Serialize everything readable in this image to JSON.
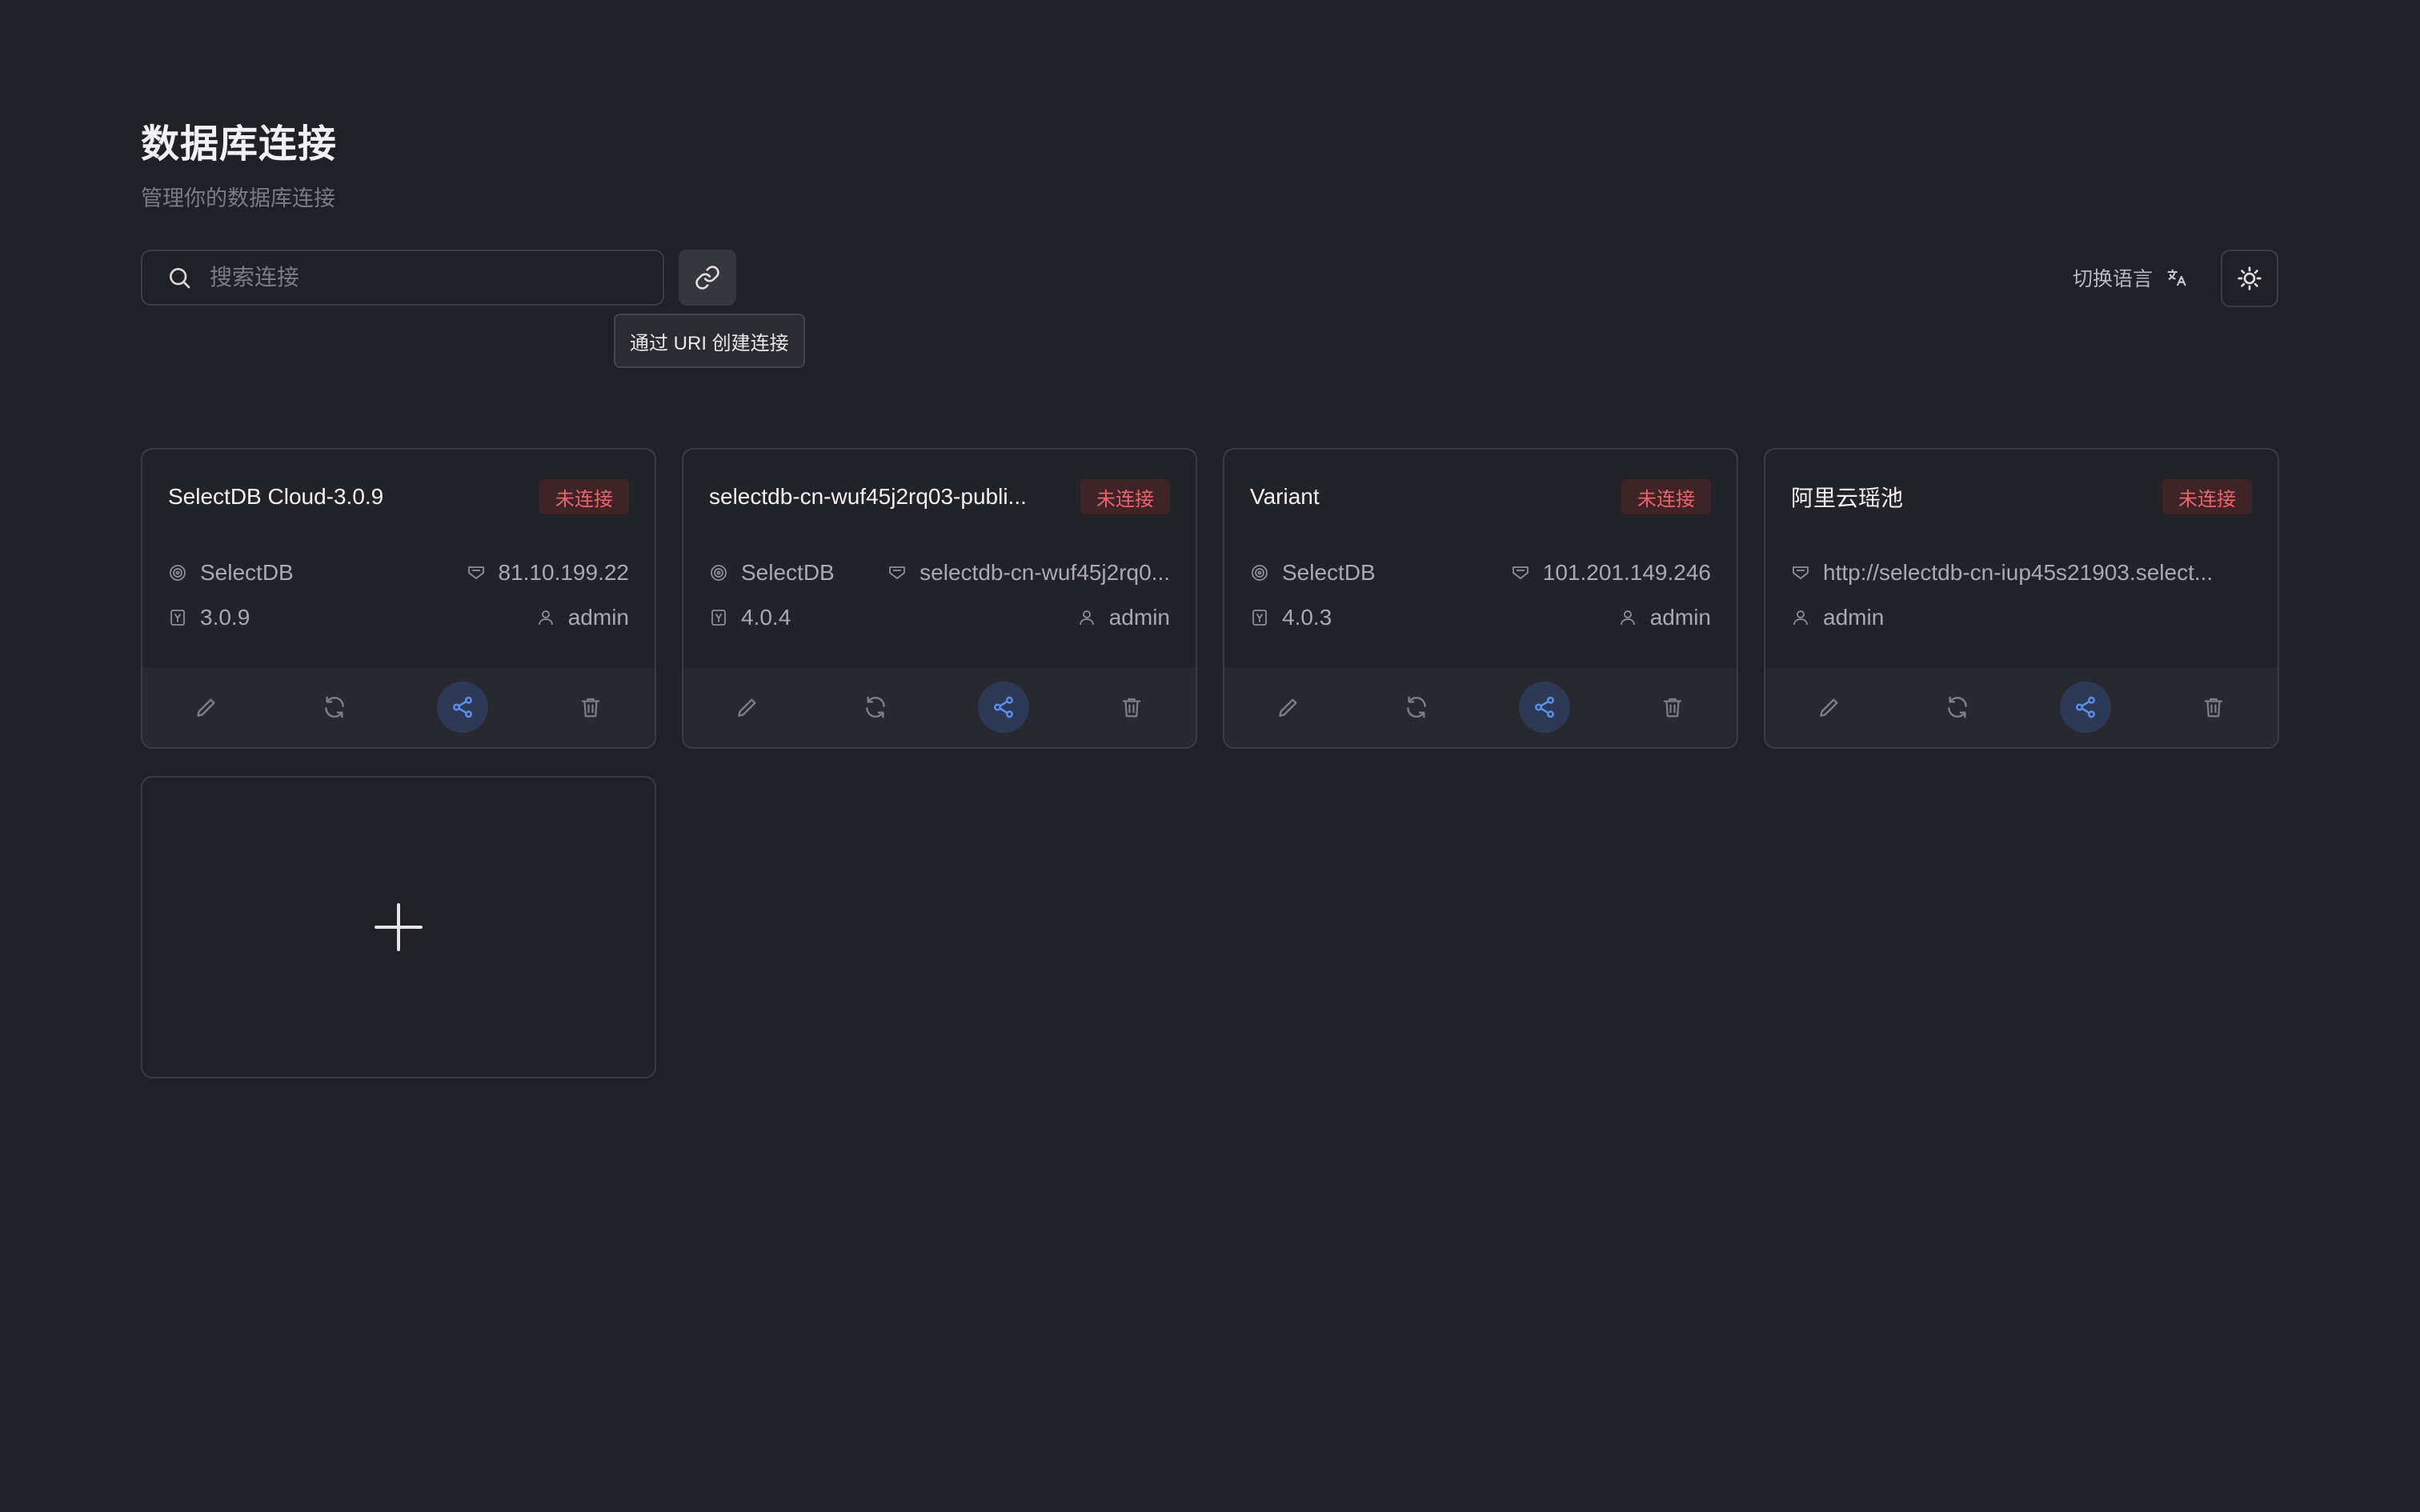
{
  "header": {
    "title": "数据库连接",
    "subtitle": "管理你的数据库连接"
  },
  "toolbar": {
    "search_placeholder": "搜索连接",
    "search_value": "",
    "uri_tooltip": "通过 URI 创建连接",
    "language_label": "切换语言"
  },
  "connections": [
    {
      "name": "SelectDB Cloud-3.0.9",
      "status": "未连接",
      "type": "SelectDB",
      "host": "81.10.199.22",
      "version": "3.0.9",
      "user": "admin"
    },
    {
      "name": "selectdb-cn-wuf45j2rq03-publi...",
      "status": "未连接",
      "type": "SelectDB",
      "host": "selectdb-cn-wuf45j2rq0...",
      "version": "4.0.4",
      "user": "admin"
    },
    {
      "name": "Variant",
      "status": "未连接",
      "type": "SelectDB",
      "host": "101.201.149.246",
      "version": "4.0.3",
      "user": "admin"
    },
    {
      "name": "阿里云瑶池",
      "status": "未连接",
      "host": "http://selectdb-cn-iup45s21903.select...",
      "user": "admin"
    }
  ],
  "colors": {
    "background": "#202126",
    "card_border": "#3b3c43",
    "status_text": "#f0626a",
    "status_bg": "#3e2327",
    "accent": "#5b8ff0"
  },
  "icons": {
    "search": "search-icon",
    "uri": "link-icon",
    "language": "translate-icon",
    "theme": "sun-icon",
    "edit": "pencil-icon",
    "refresh": "refresh-icon",
    "share": "share-icon",
    "delete": "trash-icon",
    "add": "plus-icon"
  }
}
